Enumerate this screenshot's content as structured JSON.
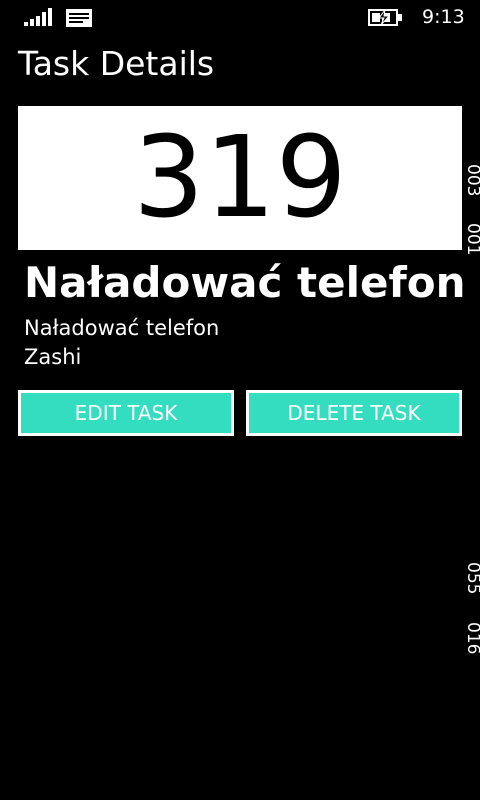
{
  "status_bar": {
    "time": "9:13",
    "signal_icon": "signal-strength-icon",
    "message_icon": "message-icon",
    "battery_icon": "battery-charging-icon"
  },
  "page": {
    "title": "Task Details"
  },
  "task": {
    "number": "319",
    "title": "Naładować telefon",
    "description": "Naładować telefon",
    "owner": "Zashi"
  },
  "side_labels": [
    "003",
    "001",
    "055",
    "016"
  ],
  "actions": {
    "edit_label": "EDIT TASK",
    "delete_label": "DELETE TASK"
  },
  "colors": {
    "background": "#000000",
    "card": "#ffffff",
    "accent": "#34dcc0",
    "text": "#ffffff"
  }
}
